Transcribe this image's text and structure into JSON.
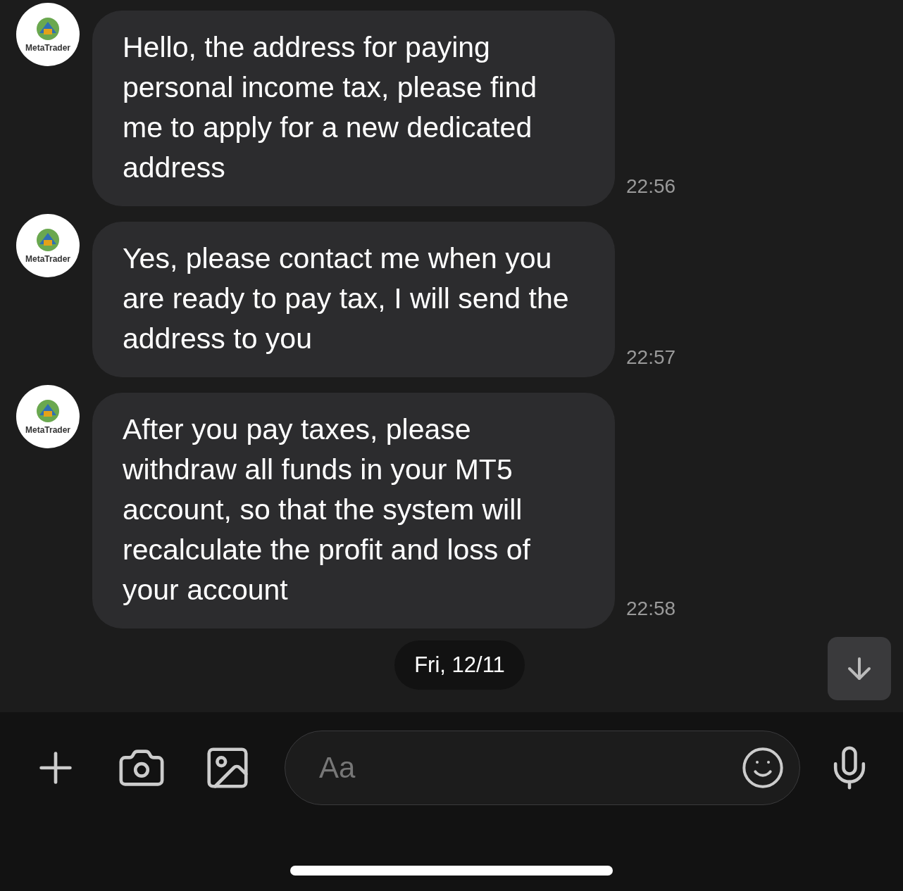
{
  "messages": [
    {
      "avatar_label": "MetaTrader",
      "text": "Hello, the address for paying personal income tax, please find me to apply for a new dedicated address",
      "time": "22:56"
    },
    {
      "avatar_label": "MetaTrader",
      "text": "Yes, please contact me when you are ready to pay tax, I will send the address to you",
      "time": "22:57"
    },
    {
      "avatar_label": "MetaTrader",
      "text": "After you pay taxes, please withdraw all funds in your MT5 account, so that the system will recalculate the profit and loss of your account",
      "time": "22:58"
    }
  ],
  "date_separator": "Fri, 12/11",
  "composer": {
    "placeholder": "Aa"
  }
}
